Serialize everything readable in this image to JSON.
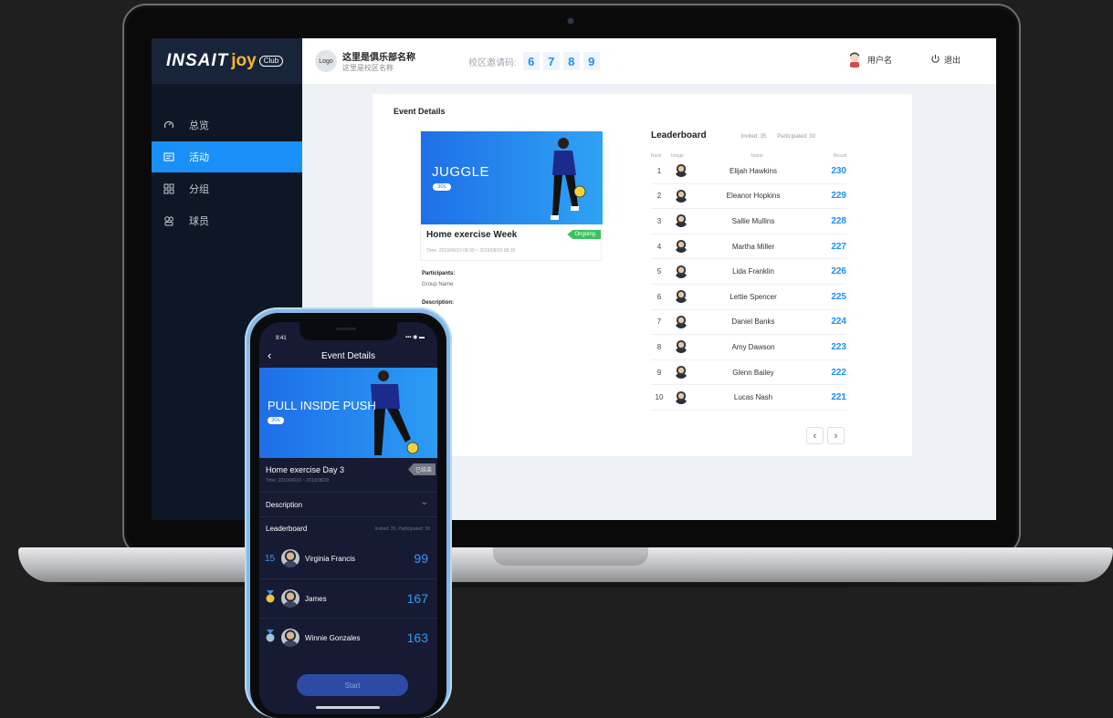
{
  "sidebar": {
    "brand": {
      "name": "INSAIT",
      "joy": "joy",
      "club": "Club"
    },
    "items": [
      {
        "label": "总览",
        "icon": "gauge-icon",
        "active": false
      },
      {
        "label": "活动",
        "icon": "calendar-icon",
        "active": true
      },
      {
        "label": "分组",
        "icon": "grid-icon",
        "active": false
      },
      {
        "label": "球员",
        "icon": "players-icon",
        "active": false
      }
    ]
  },
  "topbar": {
    "logo": "Logo",
    "club_name": "这里是俱乐部名称",
    "campus_name": "这里是校区名称",
    "invite_label": "校区邀请码:",
    "invite_digits": [
      "6",
      "7",
      "8",
      "9"
    ],
    "user_name": "用户名",
    "logout": "退出"
  },
  "event": {
    "section_title": "Event Details",
    "banner_title": "JUGGLE",
    "banner_pill": "30s",
    "name": "Home exercise Week",
    "status": "Ongoing",
    "time": "Time: 2019/06/10 08:30 ~ 2019/08/20 08:30",
    "participants_label": "Participants:",
    "participants_value": "Group Name",
    "description_label": "Description:"
  },
  "leaderboard": {
    "title": "Leaderboard",
    "invited": "Invited: 35",
    "participated": "Participated: 30",
    "columns": {
      "rank": "Rank",
      "image": "Image",
      "name": "Name",
      "result": "Result"
    },
    "rows": [
      {
        "rank": "1",
        "name": "Elijah Hawkins",
        "result": "230"
      },
      {
        "rank": "2",
        "name": "Eleanor Hopkins",
        "result": "229"
      },
      {
        "rank": "3",
        "name": "Sallie Mullins",
        "result": "228"
      },
      {
        "rank": "4",
        "name": "Martha Miller",
        "result": "227"
      },
      {
        "rank": "5",
        "name": "Lida Franklin",
        "result": "226"
      },
      {
        "rank": "6",
        "name": "Lettie Spencer",
        "result": "225"
      },
      {
        "rank": "7",
        "name": "Daniel Banks",
        "result": "224"
      },
      {
        "rank": "8",
        "name": "Amy Dawson",
        "result": "223"
      },
      {
        "rank": "9",
        "name": "Glenn Bailey",
        "result": "222"
      },
      {
        "rank": "10",
        "name": "Lucas Nash",
        "result": "221"
      }
    ],
    "prev": "‹",
    "next": "›"
  },
  "phone": {
    "time": "9:41",
    "status_icons": "▪▪▪ ◉ ▬",
    "back": "‹",
    "title": "Event Details",
    "banner_title": "PULL INSIDE PUSH",
    "banner_pill": "30s",
    "event_name": "Home exercise Day 3",
    "event_tag": "已结束",
    "event_time": "Time: 2019/06/10 ~ 2019/08/20",
    "description": "Description",
    "chevron": "⌄",
    "leaderboard": "Leaderboard",
    "lb_stat": "Invited: 35,  Participated: 30",
    "rows": [
      {
        "rank": "15",
        "name": "Virginia Francis",
        "score": "99"
      },
      {
        "medal": "gold",
        "name": "James",
        "score": "167"
      },
      {
        "medal": "silver",
        "name": "Winnie Gonzales",
        "score": "163"
      }
    ],
    "start": "Start"
  },
  "colors": {
    "accent": "#1990f8",
    "sidebar": "#0e1726",
    "ongoing": "#39c35f",
    "phone_bg": "#161a33"
  }
}
